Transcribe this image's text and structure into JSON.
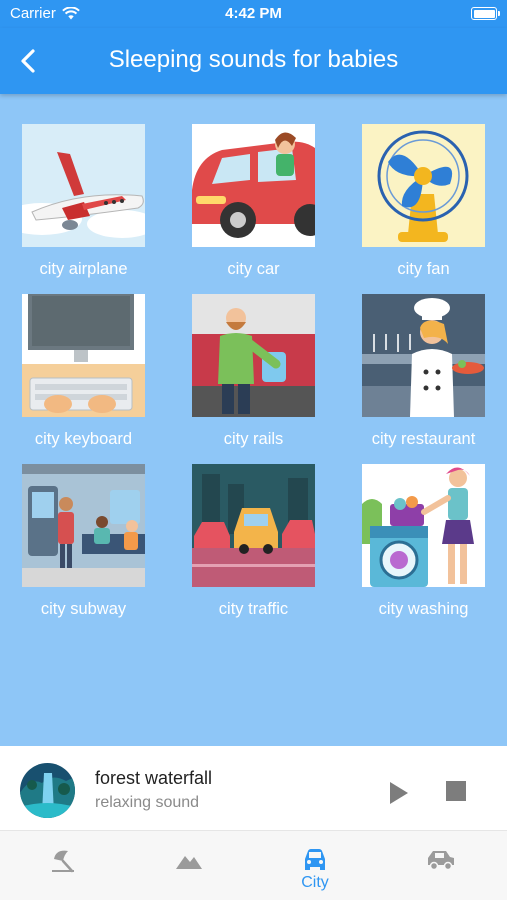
{
  "status_bar": {
    "carrier": "Carrier",
    "time": "4:42 PM"
  },
  "header": {
    "title": "Sleeping sounds for babies"
  },
  "grid": {
    "items": [
      {
        "label": "city airplane"
      },
      {
        "label": "city car"
      },
      {
        "label": "city fan"
      },
      {
        "label": "city keyboard"
      },
      {
        "label": "city rails"
      },
      {
        "label": "city restaurant"
      },
      {
        "label": "city subway"
      },
      {
        "label": "city traffic"
      },
      {
        "label": "city washing"
      }
    ]
  },
  "player": {
    "title": "forest waterfall",
    "subtitle": "relaxing sound"
  },
  "tabs": [
    {
      "icon": "umbrella-beach-icon",
      "label": ""
    },
    {
      "icon": "mountains-icon",
      "label": ""
    },
    {
      "icon": "car-icon",
      "label": "City",
      "active": true
    },
    {
      "icon": "vehicle-icon",
      "label": ""
    }
  ],
  "colors": {
    "primary": "#2f96f2",
    "background": "#8ec6f7",
    "inactive_icon": "#9b9b9b"
  }
}
